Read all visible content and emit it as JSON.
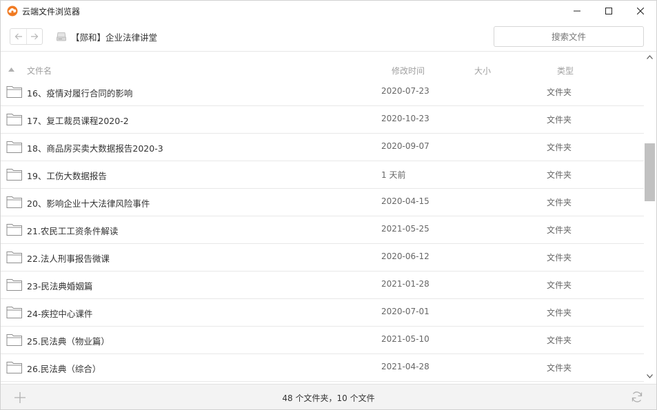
{
  "window": {
    "title": "云端文件浏览器",
    "logo_icon": "cloud-logo-icon",
    "controls": [
      "minimize-icon",
      "maximize-icon",
      "close-icon"
    ]
  },
  "toolbar": {
    "back_icon": "arrow-left-icon",
    "forward_icon": "arrow-right-icon",
    "drive_icon": "drive-icon",
    "breadcrumb": "【郧和】企业法律讲堂",
    "search_placeholder": "搜索文件"
  },
  "list": {
    "headers": {
      "name": "文件名",
      "mtime": "修改时间",
      "size": "大小",
      "type": "类型"
    },
    "rows": [
      {
        "name": "16、疫情对履行合同的影响",
        "mtime": "2020-07-23",
        "size": "",
        "type": "文件夹"
      },
      {
        "name": "17、复工裁员课程2020-2",
        "mtime": "2020-10-23",
        "size": "",
        "type": "文件夹"
      },
      {
        "name": "18、商品房买卖大数据报告2020-3",
        "mtime": "2020-09-07",
        "size": "",
        "type": "文件夹"
      },
      {
        "name": "19、工伤大数据报告",
        "mtime": "1 天前",
        "size": "",
        "type": "文件夹"
      },
      {
        "name": "20、影响企业十大法律风险事件",
        "mtime": "2020-04-15",
        "size": "",
        "type": "文件夹"
      },
      {
        "name": "21.农民工工资条件解读",
        "mtime": "2021-05-25",
        "size": "",
        "type": "文件夹"
      },
      {
        "name": "22.法人刑事报告微课",
        "mtime": "2020-06-12",
        "size": "",
        "type": "文件夹"
      },
      {
        "name": "23-民法典婚姻篇",
        "mtime": "2021-01-28",
        "size": "",
        "type": "文件夹"
      },
      {
        "name": "24-疾控中心课件",
        "mtime": "2020-07-01",
        "size": "",
        "type": "文件夹"
      },
      {
        "name": "25.民法典（物业篇）",
        "mtime": "2021-05-10",
        "size": "",
        "type": "文件夹"
      },
      {
        "name": "26.民法典（综合）",
        "mtime": "2021-04-28",
        "size": "",
        "type": "文件夹"
      }
    ]
  },
  "statusbar": {
    "summary": "48 个文件夹，10 个文件",
    "add_icon": "plus-icon",
    "refresh_icon": "refresh-icon"
  },
  "colors": {
    "logo_orange": "#f07a22",
    "scroll_thumb": "#c1c1c1",
    "status_bg": "#f3f3f3"
  }
}
